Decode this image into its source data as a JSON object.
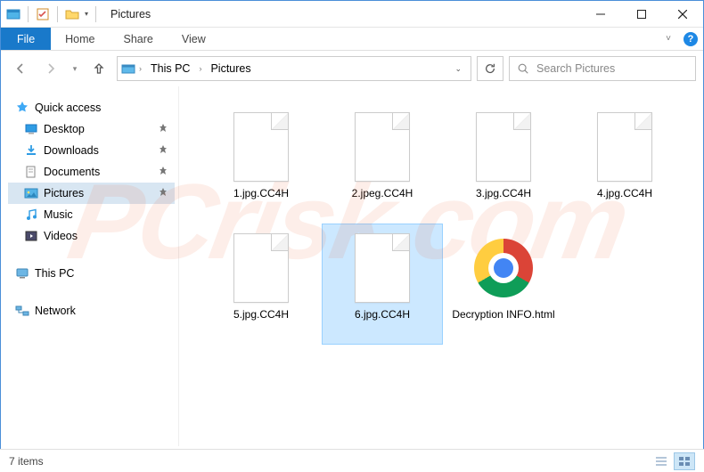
{
  "window": {
    "title": "Pictures"
  },
  "ribbon": {
    "file": "File",
    "tabs": [
      "Home",
      "Share",
      "View"
    ]
  },
  "breadcrumb": {
    "root": "This PC",
    "current": "Pictures"
  },
  "search": {
    "placeholder": "Search Pictures"
  },
  "sidebar": {
    "quick_access": "Quick access",
    "items": [
      {
        "label": "Desktop",
        "pinned": true
      },
      {
        "label": "Downloads",
        "pinned": true
      },
      {
        "label": "Documents",
        "pinned": true
      },
      {
        "label": "Pictures",
        "pinned": true,
        "active": true
      },
      {
        "label": "Music",
        "pinned": false
      },
      {
        "label": "Videos",
        "pinned": false
      }
    ],
    "this_pc": "This PC",
    "network": "Network"
  },
  "files": [
    {
      "name": "1.jpg.CC4H",
      "type": "blank"
    },
    {
      "name": "2.jpeg.CC4H",
      "type": "blank"
    },
    {
      "name": "3.jpg.CC4H",
      "type": "blank"
    },
    {
      "name": "4.jpg.CC4H",
      "type": "blank"
    },
    {
      "name": "5.jpg.CC4H",
      "type": "blank"
    },
    {
      "name": "6.jpg.CC4H",
      "type": "blank",
      "selected": true
    },
    {
      "name": "Decryption INFO.html",
      "type": "chrome"
    }
  ],
  "status": {
    "count": "7 items"
  },
  "colors": {
    "accent": "#1979ca",
    "selection": "#cce8ff"
  },
  "watermark": "PCrisk.com"
}
